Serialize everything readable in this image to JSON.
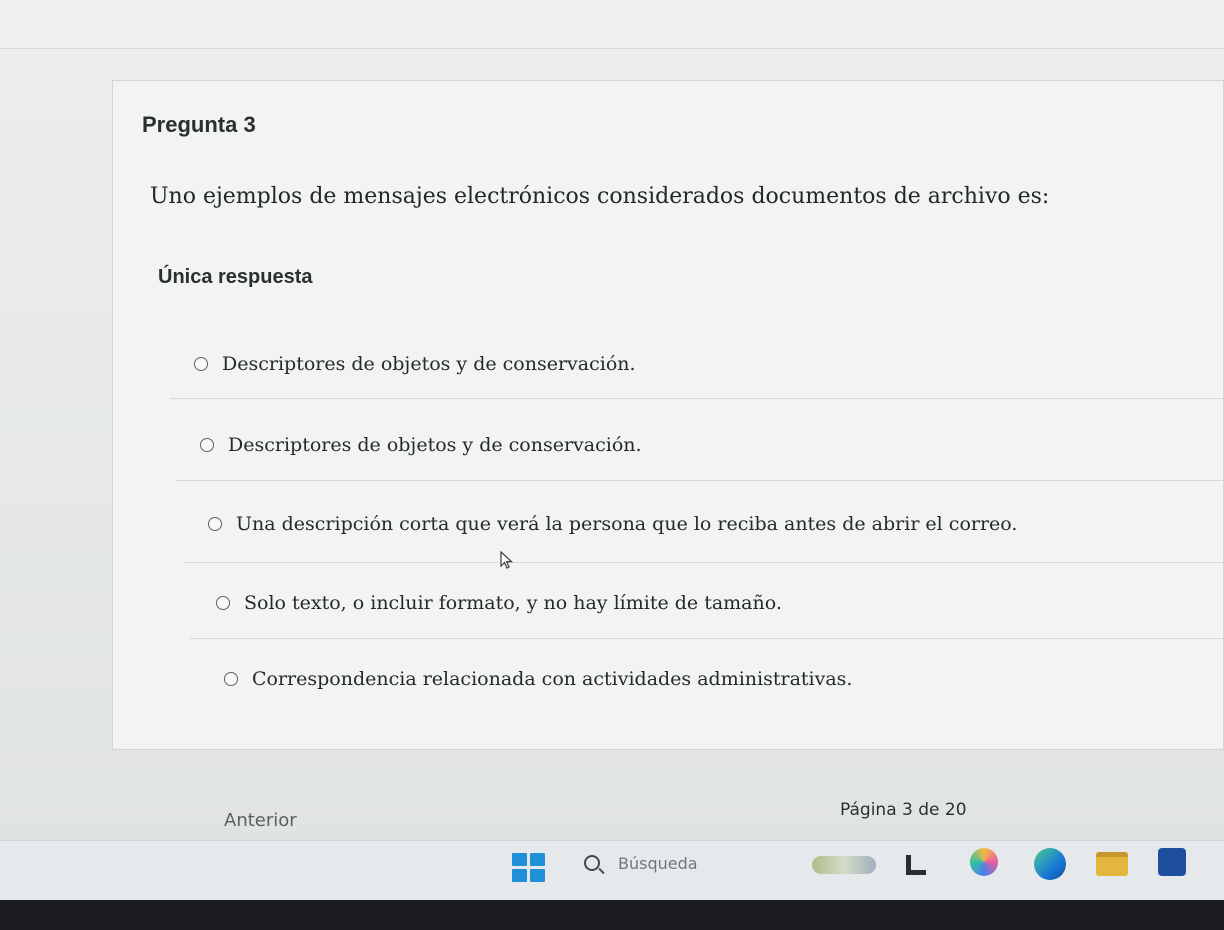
{
  "question": {
    "title": "Pregunta 3",
    "text": "Uno ejemplos de mensajes electrónicos considerados documentos de archivo es:",
    "answer_type": "Única respuesta",
    "options": [
      {
        "label": "Descriptores de objetos y de conservación.",
        "selected": false
      },
      {
        "label": "Descriptores de objetos y de conservación.",
        "selected": false
      },
      {
        "label": "Una descripción corta que verá la persona que lo reciba antes de abrir el correo.",
        "selected": false
      },
      {
        "label": "Solo texto, o incluir formato, y no hay límite de tamaño.",
        "selected": false
      },
      {
        "label": "Correspondencia relacionada con actividades administrativas.",
        "selected": false
      }
    ]
  },
  "navigation": {
    "prev_label": "Anterior",
    "page_indicator": "Página 3 de 20"
  },
  "taskbar": {
    "search_placeholder": "Búsqueda",
    "icons": [
      "windows-start-icon",
      "search-icon",
      "weather-icon",
      "task-view-icon",
      "copilot-icon",
      "edge-browser-icon",
      "file-explorer-icon",
      "store-icon"
    ],
    "accent_color": "#1f8fd8"
  }
}
